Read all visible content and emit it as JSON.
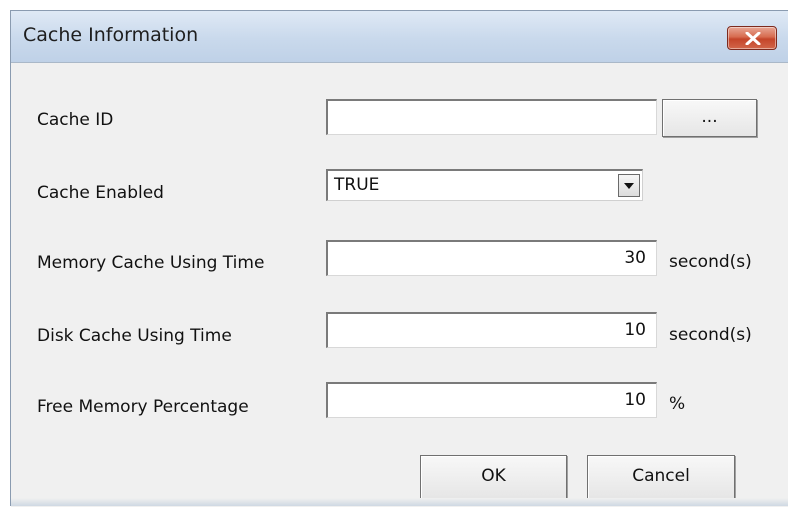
{
  "window": {
    "title": "Cache Information",
    "close_icon": "close-icon"
  },
  "form": {
    "cache_id": {
      "label": "Cache ID",
      "value": "",
      "browse_label": "..."
    },
    "cache_enabled": {
      "label": "Cache Enabled",
      "selected": "TRUE",
      "dropdown_icon": "chevron-down-icon"
    },
    "memory_cache_time": {
      "label": "Memory Cache Using Time",
      "value": "30",
      "unit": "second(s)"
    },
    "disk_cache_time": {
      "label": "Disk Cache Using Time",
      "value": "10",
      "unit": "second(s)"
    },
    "free_memory_percentage": {
      "label": "Free Memory Percentage",
      "value": "10",
      "unit": "%"
    }
  },
  "buttons": {
    "ok": "OK",
    "cancel": "Cancel"
  },
  "colors": {
    "title_bar": "#c9d9ec",
    "close_button": "#c4452a",
    "dialog_background": "#f0f0f0"
  }
}
